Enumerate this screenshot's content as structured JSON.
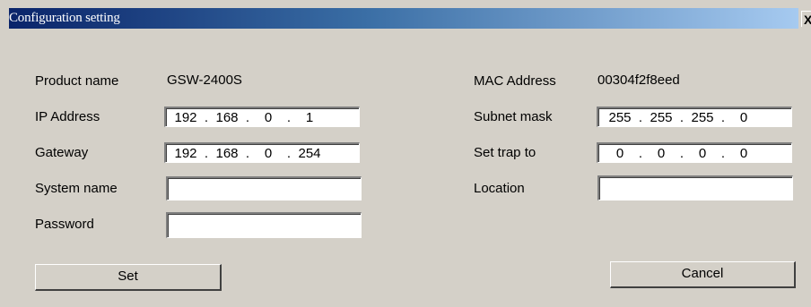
{
  "window": {
    "title": "Configuration setting",
    "close_glyph": "X"
  },
  "left": {
    "product_name_label": "Product name",
    "product_name_value": "GSW-2400S",
    "ip_label": "IP Address",
    "ip": [
      "192",
      "168",
      "0",
      "1"
    ],
    "gateway_label": "Gateway",
    "gateway": [
      "192",
      "168",
      "0",
      "254"
    ],
    "system_name_label": "System name",
    "system_name_value": "",
    "password_label": "Password",
    "password_value": ""
  },
  "right": {
    "mac_label": "MAC Address",
    "mac_value": "00304f2f8eed",
    "subnet_label": "Subnet mask",
    "subnet": [
      "255",
      "255",
      "255",
      "0"
    ],
    "trap_label": "Set trap to",
    "trap": [
      "0",
      "0",
      "0",
      "0"
    ],
    "location_label": "Location",
    "location_value": ""
  },
  "buttons": {
    "set_label": "Set",
    "cancel_label": "Cancel"
  },
  "ip_separator": "."
}
